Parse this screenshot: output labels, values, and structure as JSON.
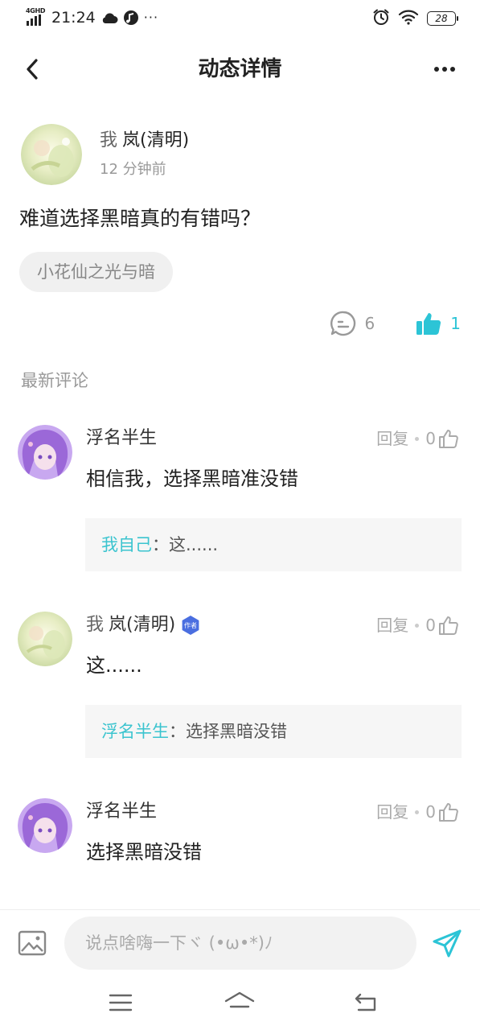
{
  "status_bar": {
    "network": "4GHD",
    "time": "21:24",
    "overflow": "···",
    "battery": "28",
    "icons": [
      "signal-icon",
      "cloud-icon",
      "music-icon",
      "alarm-icon",
      "wifi-icon",
      "battery-icon"
    ]
  },
  "header": {
    "title": "动态详情",
    "back_icon": "chevron-left-icon",
    "more_icon": "more-dots-icon"
  },
  "post": {
    "author_prefix": "我",
    "author_name": "岚(清明)",
    "time": "12 分钟前",
    "text": "难道选择黑暗真的有错吗？",
    "topic": "小花仙之光与暗",
    "comment_count": "6",
    "like_count": "1"
  },
  "comments_section": {
    "title": "最新评论"
  },
  "comments": [
    {
      "name": "浮名半生",
      "reply_label": "回复",
      "likes": "0",
      "text": "相信我，选择黑暗准没错",
      "quote_name": "我自己",
      "quote_sep": "：",
      "quote_text": "这......"
    },
    {
      "name_prefix": "我",
      "name": "岚(清明)",
      "badge": "作者",
      "reply_label": "回复",
      "likes": "0",
      "text": "这......",
      "quote_name": "浮名半生",
      "quote_sep": "：",
      "quote_text": "选择黑暗没错"
    },
    {
      "name": "浮名半生",
      "reply_label": "回复",
      "likes": "0",
      "text": "选择黑暗没错"
    }
  ],
  "input_bar": {
    "placeholder": "说点啥嗨一下ヾ (•ω•*)ﾉ"
  },
  "colors": {
    "accent": "#2cc4d6",
    "quote_name": "#3bc4cf",
    "badge": "#4a6ee0"
  }
}
